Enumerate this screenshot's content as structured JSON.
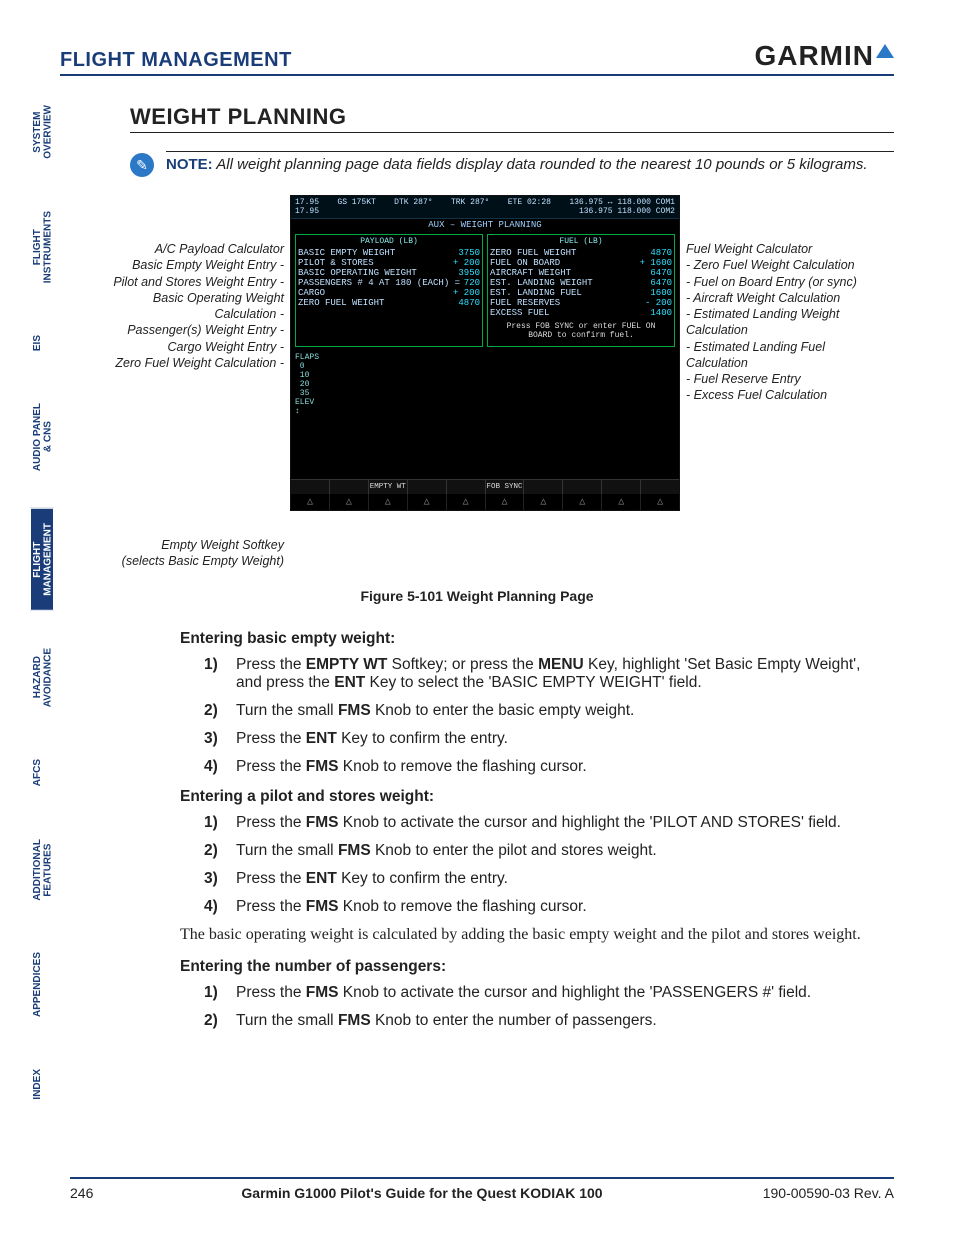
{
  "header": {
    "breadcrumb": "FLIGHT MANAGEMENT",
    "brand": "GARMIN"
  },
  "section_title": "WEIGHT PLANNING",
  "tabs": [
    "SYSTEM\nOVERVIEW",
    "FLIGHT\nINSTRUMENTS",
    "EIS",
    "AUDIO PANEL\n& CNS",
    "FLIGHT\nMANAGEMENT",
    "HAZARD\nAVOIDANCE",
    "AFCS",
    "ADDITIONAL\nFEATURES",
    "APPENDICES",
    "INDEX"
  ],
  "active_tab_index": 4,
  "note": {
    "lead": "NOTE:",
    "text": "All weight planning page data fields display data rounded to the nearest 10 pounds or 5 kilograms."
  },
  "figure": {
    "left_head": "A/C Payload Calculator",
    "left_items": [
      "Basic Empty Weight Entry -",
      "Pilot and Stores Weight Entry -",
      "Basic Operating Weight Calculation -",
      "Passenger(s) Weight Entry -",
      "Cargo Weight Entry -",
      "Zero Fuel Weight Calculation -"
    ],
    "left_softkey_head": "Empty Weight Softkey",
    "left_softkey_sub": "(selects Basic Empty Weight)",
    "right_head": "Fuel Weight Calculator",
    "right_items": [
      "- Zero Fuel Weight Calculation",
      "- Fuel on Board Entry (or sync)",
      "- Aircraft Weight Calculation",
      "- Estimated Landing Weight Calculation",
      "- Estimated Landing Fuel Calculation",
      "- Fuel Reserve Entry",
      "- Excess Fuel Calculation"
    ],
    "screen": {
      "top_left": "17.95",
      "top_left2": "17.95",
      "gs": "GS 175KT",
      "dtk": "DTK 287°",
      "trk": "TRK 287°",
      "ete": "ETE 02:28",
      "com_a": "136.975 ↔ 118.000 COM1",
      "com_b": "136.975    118.000 COM2",
      "title": "AUX – WEIGHT PLANNING",
      "payload_title": "PAYLOAD (LB)",
      "fuel_title": "FUEL (LB)",
      "payload_rows": [
        [
          "BASIC EMPTY WEIGHT",
          "3750"
        ],
        [
          "PILOT & STORES",
          "+  200"
        ],
        [
          "BASIC OPERATING WEIGHT",
          "3950"
        ],
        [
          "PASSENGERS #  4 AT  180 (EACH) =",
          "720"
        ],
        [
          "CARGO",
          "+  200"
        ],
        [
          "ZERO FUEL WEIGHT",
          "4870"
        ]
      ],
      "fuel_rows": [
        [
          "ZERO FUEL WEIGHT",
          "4870"
        ],
        [
          "FUEL ON BOARD",
          "+ 1600"
        ],
        [
          "AIRCRAFT WEIGHT",
          "6470"
        ],
        [
          "EST. LANDING WEIGHT",
          "6470"
        ],
        [
          "EST. LANDING FUEL",
          "1600"
        ],
        [
          "FUEL RESERVES",
          "-  200"
        ],
        [
          "EXCESS FUEL",
          "1400"
        ]
      ],
      "msg": "Press FOB SYNC or enter FUEL ON BOARD to confirm fuel.",
      "flaps": "FLAPS\n 0\n 10\n 20\n 35\nELEV\n↕",
      "softkeys": [
        "",
        "",
        "EMPTY WT",
        "",
        "",
        "FOB SYNC",
        "",
        "",
        "",
        ""
      ]
    },
    "caption": "Figure 5-101  Weight Planning Page"
  },
  "procs": [
    {
      "head": "Entering basic empty weight:",
      "steps": [
        [
          [
            "Press the "
          ],
          [
            "b",
            "EMPTY WT"
          ],
          [
            " Softkey; or press the "
          ],
          [
            "b",
            "MENU"
          ],
          [
            " Key, highlight 'Set Basic Empty Weight', and press the "
          ],
          [
            "b",
            "ENT"
          ],
          [
            " Key to select the 'BASIC EMPTY WEIGHT' field."
          ]
        ],
        [
          [
            "Turn the small "
          ],
          [
            "b",
            "FMS"
          ],
          [
            " Knob to enter the basic empty weight."
          ]
        ],
        [
          [
            "Press the "
          ],
          [
            "b",
            "ENT"
          ],
          [
            " Key to confirm the entry."
          ]
        ],
        [
          [
            "Press the "
          ],
          [
            "b",
            "FMS"
          ],
          [
            " Knob to remove the flashing cursor."
          ]
        ]
      ]
    },
    {
      "head": "Entering a pilot and stores weight:",
      "steps": [
        [
          [
            "Press the "
          ],
          [
            "b",
            "FMS"
          ],
          [
            " Knob to activate the cursor and highlight the 'PILOT AND STORES' field."
          ]
        ],
        [
          [
            "Turn the small "
          ],
          [
            "b",
            "FMS"
          ],
          [
            " Knob to enter the pilot and stores weight."
          ]
        ],
        [
          [
            "Press the "
          ],
          [
            "b",
            "ENT"
          ],
          [
            " Key to confirm the entry."
          ]
        ],
        [
          [
            "Press the "
          ],
          [
            "b",
            "FMS"
          ],
          [
            " Knob to remove the flashing cursor."
          ]
        ]
      ]
    }
  ],
  "mid_para": "The basic operating weight is calculated by adding the basic empty weight and the pilot and stores weight.",
  "proc3": {
    "head": "Entering the number of passengers:",
    "steps": [
      [
        [
          "Press the "
        ],
        [
          "b",
          "FMS"
        ],
        [
          " Knob to activate the cursor and highlight the 'PASSENGERS #' field."
        ]
      ],
      [
        [
          "Turn the small "
        ],
        [
          "b",
          "FMS"
        ],
        [
          " Knob to enter the number of passengers."
        ]
      ]
    ]
  },
  "footer": {
    "page": "246",
    "title": "Garmin G1000 Pilot's Guide for the Quest KODIAK 100",
    "doc": "190-00590-03  Rev. A"
  }
}
